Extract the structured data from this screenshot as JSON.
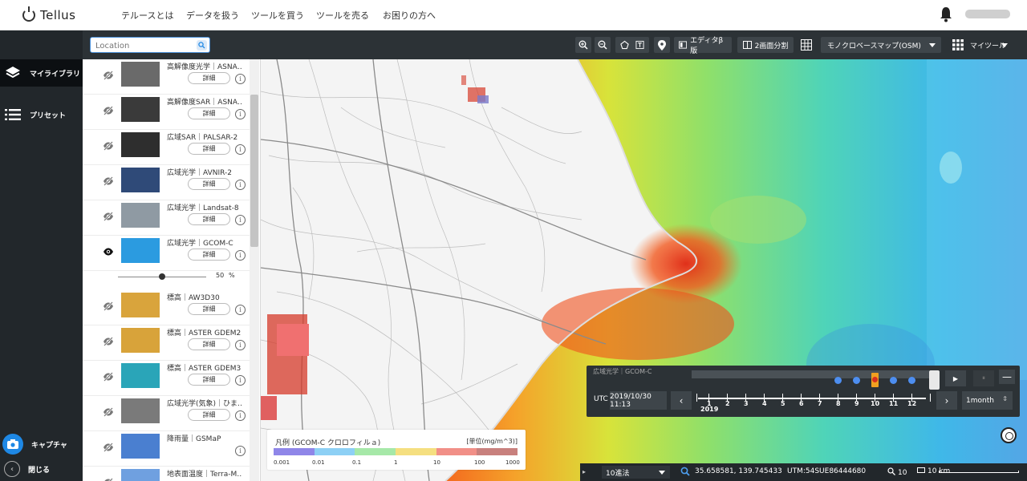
{
  "nav": {
    "brand": "Tellus",
    "items": [
      "テルースとは",
      "データを扱う",
      "ツールを買う",
      "ツールを売る",
      "お困りの方へ"
    ]
  },
  "rail": {
    "library": "マイライブラリ",
    "preset": "プリセット",
    "capture": "キャプチャ",
    "close": "閉じる"
  },
  "toolbar": {
    "location_placeholder": "Location",
    "editor": "エディタβ版",
    "split": "2画面分割",
    "basemap": "モノクロベースマップ(OSM)",
    "mytools": "マイツール"
  },
  "layers": [
    {
      "name": "高解像度光学｜ASNA…",
      "detail": "詳細",
      "visible": false,
      "thumb": "#6a6a6a"
    },
    {
      "name": "高解像度SAR｜ASNA…",
      "detail": "詳細",
      "visible": false,
      "thumb": "#3a3a3a"
    },
    {
      "name": "広域SAR｜PALSAR-2",
      "detail": "詳細",
      "visible": false,
      "thumb": "#2e2e2e"
    },
    {
      "name": "広域光学｜AVNIR-2",
      "detail": "詳細",
      "visible": false,
      "thumb": "#2f4a78"
    },
    {
      "name": "広域光学｜Landsat-8",
      "detail": "詳細",
      "visible": false,
      "thumb": "#8f9aa3"
    },
    {
      "name": "広域光学｜GCOM-C",
      "detail": "詳細",
      "visible": true,
      "thumb": "#2b9be0"
    },
    {
      "name": "標高｜AW3D30",
      "detail": "詳細",
      "visible": false,
      "thumb": "#d9a43c"
    },
    {
      "name": "標高｜ASTER GDEM2",
      "detail": "詳細",
      "visible": false,
      "thumb": "#d8a33a"
    },
    {
      "name": "標高｜ASTER GDEM3",
      "detail": "詳細",
      "visible": false,
      "thumb": "#2aa5b8"
    },
    {
      "name": "広域光学(気象)｜ひま…",
      "detail": "詳細",
      "visible": false,
      "thumb": "#7a7a7a"
    },
    {
      "name": "降雨量｜GSMaP",
      "detail": "",
      "visible": false,
      "thumb": "#4a7fd0"
    },
    {
      "name": "地表面温度｜Terra-M…",
      "detail": "",
      "visible": false,
      "thumb": "#6fa0e0"
    }
  ],
  "opacity": {
    "value": "50",
    "unit": "%",
    "fraction": 0.5
  },
  "legend": {
    "title": "凡例 (GCOM-C クロロフィルａ)",
    "unit": "[単位(mg/m^3)]",
    "colors": [
      "#8f86e8",
      "#8dd0f5",
      "#a6e8a8",
      "#f5df80",
      "#f18f87",
      "#c8807d"
    ],
    "ticks": [
      "0.001",
      "0.01",
      "0.1",
      "1",
      "10",
      "100",
      "1000"
    ]
  },
  "time": {
    "layer_label": "広域光学｜GCOM-C",
    "utc_label": "UTC",
    "datetime": "2019/10/30 11:13",
    "year": "2019",
    "months": [
      "1",
      "2",
      "3",
      "4",
      "5",
      "6",
      "7",
      "8",
      "9",
      "10",
      "11",
      "12"
    ],
    "interval": "1month",
    "play": "▶",
    "pause": "⏸",
    "prev": "‹",
    "next": "›",
    "collapse": "—"
  },
  "status": {
    "notation": "10進法",
    "coords": "35.658581, 139.745433",
    "utm": "UTM:54SUE86444680",
    "zoom": "10",
    "scale": "10 km"
  },
  "colors": {
    "accent": "#1e88e5",
    "toolbar": "#2c3236",
    "rail": "#22272b"
  }
}
